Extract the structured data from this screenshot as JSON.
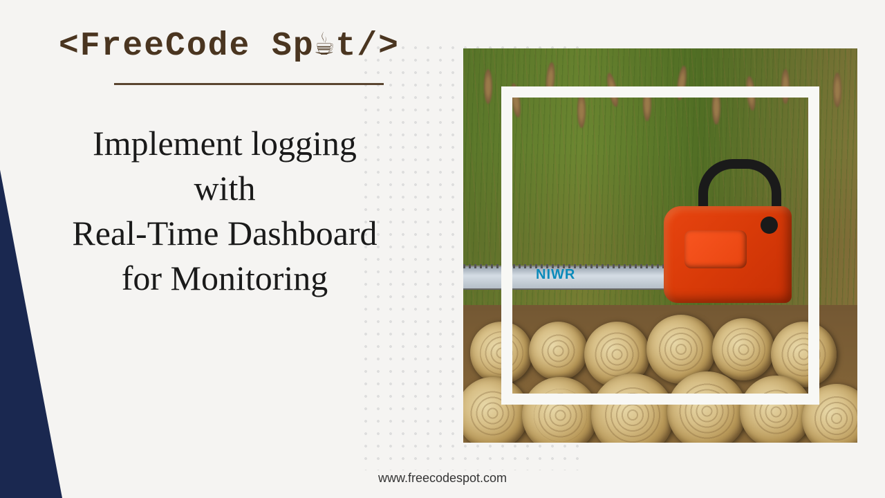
{
  "logo": {
    "text": "<FreeCode Sp☕t/>"
  },
  "headline": {
    "line1": "Implement logging",
    "line2": "with",
    "line3": "Real-Time Dashboard",
    "line4": "for Monitoring"
  },
  "image": {
    "brand_label": "NIWR",
    "description": "orange chainsaw on stacked logs with tall grass background"
  },
  "footer": {
    "url": "www.freecodespot.com"
  }
}
